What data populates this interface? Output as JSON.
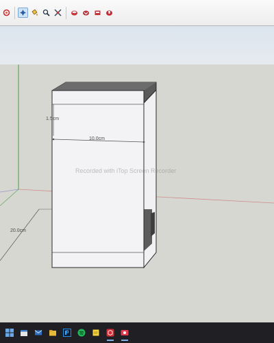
{
  "toolbar": {
    "buttons": [
      {
        "icon": "orbit-icon"
      },
      {
        "icon": "pan-icon",
        "active": true
      },
      {
        "icon": "paint-bucket-icon"
      },
      {
        "icon": "zoom-icon"
      },
      {
        "icon": "zoom-extents-icon"
      },
      {
        "icon": "warehouse-icon"
      },
      {
        "icon": "get-models-icon"
      },
      {
        "icon": "share-model-icon"
      },
      {
        "icon": "extension-warehouse-icon"
      }
    ]
  },
  "viewport": {
    "watermark": "Recorded with iTop Screen Recorder",
    "dimensions": {
      "thickness": "1.5cm",
      "width": "10.0cm",
      "depth": "20.0cm"
    }
  },
  "colors": {
    "toolbar_bg": "#f2f2f2",
    "sky": "#dde5ee",
    "ground": "#d7d7d2",
    "box_face": "#f3f3f5",
    "box_top": "#5a5a5a",
    "taskbar": "#1f1f24"
  },
  "taskbar": {
    "apps": [
      {
        "icon": "windows-start-icon"
      },
      {
        "icon": "calendar-icon"
      },
      {
        "icon": "mail-icon"
      },
      {
        "icon": "file-explorer-icon"
      },
      {
        "icon": "photoshop-icon"
      },
      {
        "icon": "spotify-icon"
      },
      {
        "icon": "sticky-notes-icon"
      },
      {
        "icon": "sketchup-icon",
        "running": true
      },
      {
        "icon": "screen-recorder-icon",
        "running": true
      }
    ]
  }
}
